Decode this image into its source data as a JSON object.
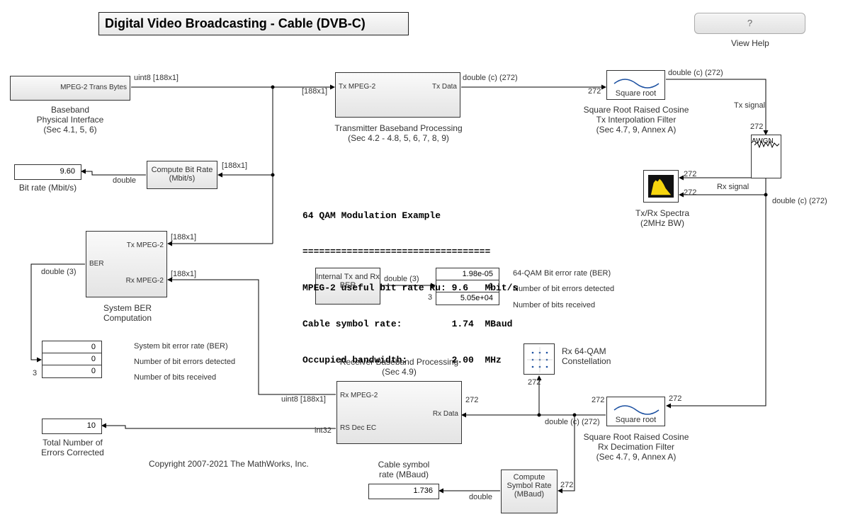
{
  "title": "Digital Video Broadcasting - Cable (DVB-C)",
  "help": {
    "button": "?",
    "caption": "View Help"
  },
  "copyright": "Copyright 2007-2021 The MathWorks, Inc.",
  "info": {
    "line1": "64 QAM Modulation Example",
    "line2": "==================================",
    "line3": "MPEG-2 useful bit rate Ru: 9.6   Mbit/s",
    "line4": "Cable symbol rate:         1.74  MBaud",
    "line5": "Occupied bandwidth:        2.00  MHz"
  },
  "blocks": {
    "mpeg2_src": {
      "out_port": "MPEG-2 Trans Bytes",
      "caption": "Baseband\nPhysical Interface\n(Sec 4.1, 5, 6)"
    },
    "transmitter": {
      "in_port": "Tx MPEG-2",
      "out_port": "Tx Data",
      "caption": "Transmitter Baseband Processing\n(Sec 4.2 - 4.8, 5, 6, 7, 8, 9)"
    },
    "tx_filter": {
      "label": "Square root",
      "caption": "Square Root Raised Cosine\nTx Interpolation Filter\n(Sec 4.7, 9, Annex A)"
    },
    "awgn": {
      "label": "AWGN"
    },
    "rx_filter": {
      "label": "Square root",
      "caption": "Square Root Raised Cosine\nRx Decimation Filter\n(Sec 4.7, 9, Annex A)"
    },
    "receiver": {
      "in_port": "Rx Data",
      "out1": "Rx MPEG-2",
      "out2": "RS Dec EC",
      "caption": "Receiver Baseband Processing\n(Sec 4.9)"
    },
    "system_ber": {
      "in1": "Tx MPEG-2",
      "in2": "Rx MPEG-2",
      "out": "BER",
      "caption": "System BER\nComputation"
    },
    "internal_ber": {
      "label": "Internal\nTx and Rx\nBER"
    },
    "compute_bitrate": {
      "label": "Compute Bit\nRate (Mbit/s)"
    },
    "compute_symrate": {
      "label": "Compute\nSymbol\nRate\n(MBaud)"
    },
    "constellation": {
      "caption": "Rx 64-QAM\nConstellation"
    },
    "spectra": {
      "caption": "Tx/Rx Spectra\n(2MHz BW)"
    }
  },
  "displays": {
    "bitrate": {
      "value": "9.60",
      "caption": "Bit rate (Mbit/s)"
    },
    "ber": {
      "r1": "0",
      "r2": "0",
      "r3": "0",
      "c1": "System bit error rate (BER)",
      "c2": "Number of bit errors detected",
      "c3": "Number of bits received"
    },
    "errors_corrected": {
      "value": "10",
      "caption": "Total Number of\nErrors Corrected"
    },
    "internal_ber_disp": {
      "r1": "1.98e-05",
      "r2": "1",
      "r3": "5.05e+04",
      "c1": "64-QAM Bit error rate (BER)",
      "c2": "Number of bit errors detected",
      "c3": "Number of bits received"
    },
    "symrate": {
      "value": "1.736",
      "caption": "Cable symbol\nrate (MBaud)"
    }
  },
  "wire_labels": {
    "src_out": "uint8 [188x1]",
    "tx_in_dim": "[188x1]",
    "tx_out": "double (c) (272)",
    "tx_in_272": "272",
    "tx_signal": "Tx signal",
    "awgn_in_272": "272",
    "rx_signal": "Rx signal",
    "double_c_272_a": "double (c) (272)",
    "rxfilt_in_272": "272",
    "rxfilt_out_a": "272",
    "rxfilt_out_label": "double (c) (272)",
    "rx_in_272": "272",
    "rx_out_dim": "uint8 [188x1]",
    "rx_out_ec": "int32",
    "ber_in1_dim": "[188x1]",
    "ber_in2_dim": "[188x1]",
    "ber_out_dim": "double (3)",
    "compute_bitrate_in": "[188x1]",
    "compute_bitrate_out": "double",
    "internal_ber_out": "double (3)",
    "disp_ber_3": "3",
    "disp_sys_3": "3",
    "const_in_272": "272",
    "spectra_in1_272": "272",
    "spectra_in2_272": "272",
    "symrate_in_272": "272",
    "symrate_out": "double"
  }
}
